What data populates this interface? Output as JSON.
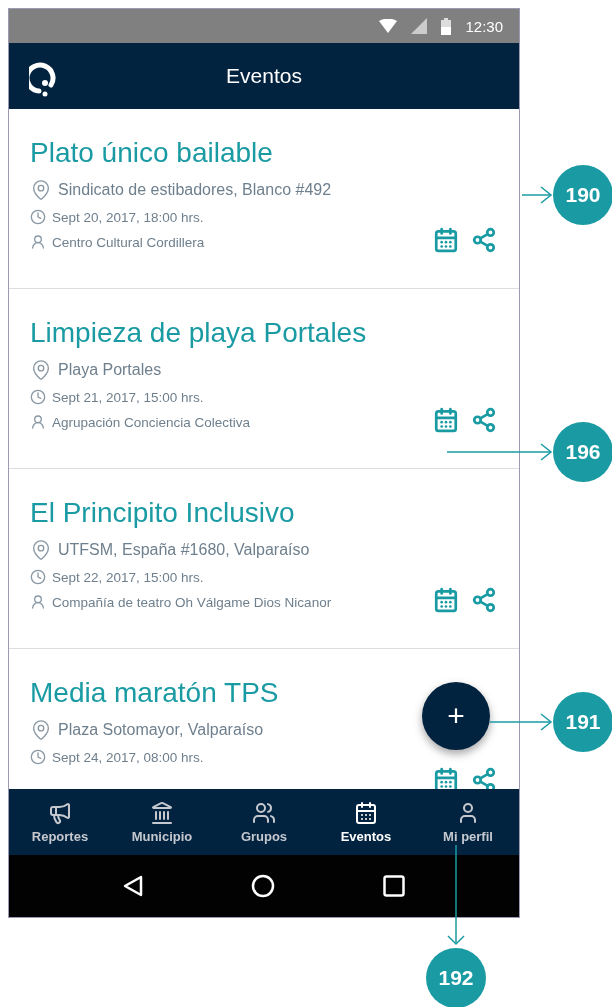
{
  "status_bar": {
    "time": "12:30"
  },
  "app_bar": {
    "title": "Eventos"
  },
  "events": [
    {
      "title": "Plato único bailable",
      "place": "Sindicato de estibadores, Blanco #492",
      "date": "Sept 20, 2017, 18:00 hrs.",
      "organizer": "Centro Cultural Cordillera"
    },
    {
      "title": "Limpieza de playa Portales",
      "place": "Playa Portales",
      "date": "Sept 21, 2017, 15:00 hrs.",
      "organizer": "Agrupación Conciencia Colectiva"
    },
    {
      "title": "El Principito Inclusivo",
      "place": "UTFSM, España #1680, Valparaíso",
      "date": "Sept 22, 2017, 15:00 hrs.",
      "organizer": "Compañía de teatro Oh Válgame Dios Nicanor"
    },
    {
      "title": "Media maratón TPS",
      "place": "Plaza Sotomayor, Valparaíso",
      "date": "Sept 24, 2017, 08:00 hrs."
    }
  ],
  "fab": {
    "label": "+"
  },
  "bottom_nav": [
    {
      "kind": "megaphone",
      "label": "Reportes",
      "selected": false
    },
    {
      "kind": "building",
      "label": "Municipio",
      "selected": false
    },
    {
      "kind": "group",
      "label": "Grupos",
      "selected": false
    },
    {
      "kind": "calendar",
      "label": "Eventos",
      "selected": true
    },
    {
      "kind": "person",
      "label": "Mi perfil",
      "selected": false
    }
  ],
  "annotations": [
    {
      "label": "190"
    },
    {
      "label": "196"
    },
    {
      "label": "191"
    },
    {
      "label": "192"
    }
  ]
}
